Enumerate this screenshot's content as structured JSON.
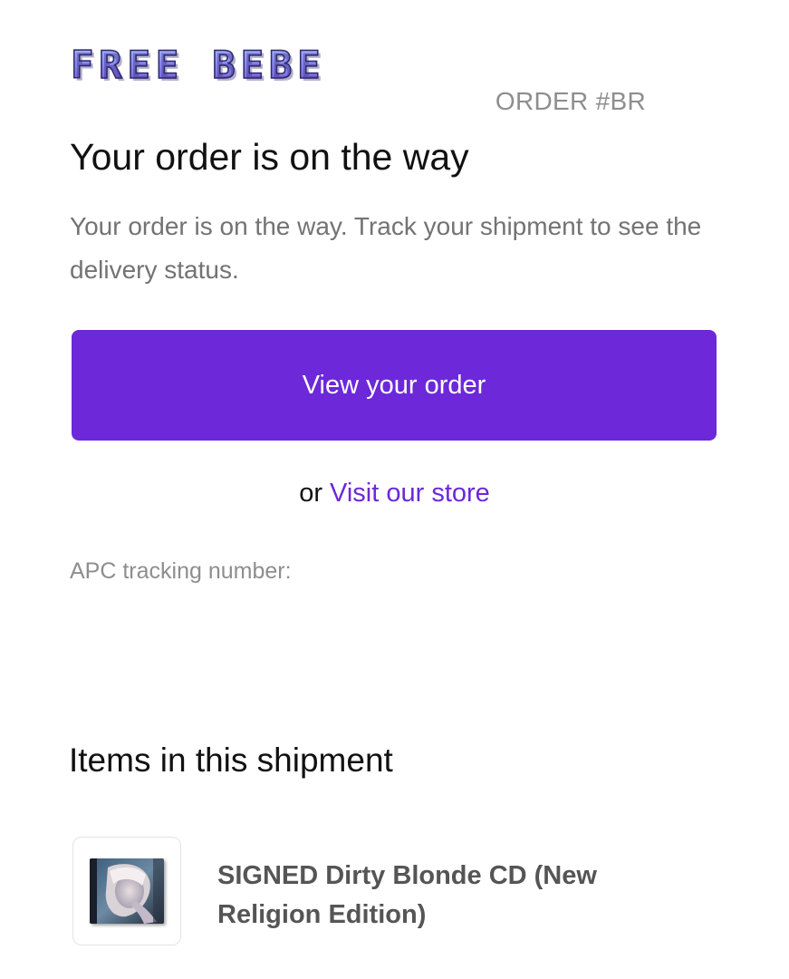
{
  "header": {
    "brand": "FREE BEBE",
    "order_number": "ORDER #BR"
  },
  "main": {
    "headline": "Your order is on the way",
    "intro": "Your order is on the way. Track your shipment to see the delivery status.",
    "cta_label": "View your order",
    "store_prefix": "or",
    "store_link_label": "Visit our store",
    "tracking_label": "APC tracking number:"
  },
  "shipment": {
    "heading": "Items in this shipment",
    "items": [
      {
        "title": "SIGNED Dirty Blonde CD (New Religion Edition)",
        "thumbnail_icon": "cd-cover-image"
      }
    ]
  },
  "colors": {
    "accent": "#6c28d9",
    "muted_text": "#737373",
    "logo": "#8d8ef3"
  }
}
